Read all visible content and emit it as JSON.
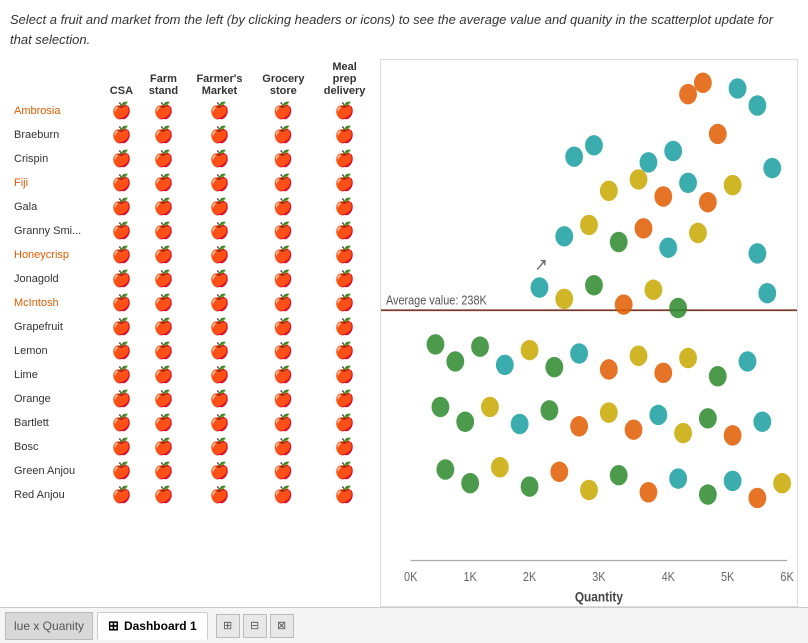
{
  "instruction": "Select a fruit and market from the left (by clicking  headers or icons) to see the average value and quanity in the scatterplot update for that selection.",
  "columns": [
    "CSA",
    "Farm stand",
    "Farmer's Market",
    "Grocery store",
    "Meal prep delivery"
  ],
  "fruits": [
    {
      "name": "Ambrosia",
      "highlight": true
    },
    {
      "name": "Braeburn",
      "highlight": false
    },
    {
      "name": "Crispin",
      "highlight": false
    },
    {
      "name": "Fiji",
      "highlight": true
    },
    {
      "name": "Gala",
      "highlight": false
    },
    {
      "name": "Granny Smi...",
      "highlight": false
    },
    {
      "name": "Honeycrisp",
      "highlight": true
    },
    {
      "name": "Jonagold",
      "highlight": false
    },
    {
      "name": "McIntosh",
      "highlight": true
    },
    {
      "name": "Grapefruit",
      "highlight": false
    },
    {
      "name": "Lemon",
      "highlight": false
    },
    {
      "name": "Lime",
      "highlight": false
    },
    {
      "name": "Orange",
      "highlight": false
    },
    {
      "name": "Bartlett",
      "highlight": false
    },
    {
      "name": "Bosc",
      "highlight": false
    },
    {
      "name": "Green Anjou",
      "highlight": false
    },
    {
      "name": "Red Anjou",
      "highlight": false
    }
  ],
  "avg_line_label": "Average value: 238K",
  "x_axis_label": "Quantity",
  "x_ticks": [
    "0K",
    "1K",
    "2K",
    "3K",
    "4K",
    "5K",
    "6K"
  ],
  "scatterplot_title": "",
  "tabs": [
    {
      "label": "lue x Quanity",
      "active": false,
      "partial": true
    },
    {
      "label": "Dashboard 1",
      "active": true,
      "icon": "⊞"
    }
  ],
  "tab_actions": [
    "⊞",
    "⊟",
    "⊠"
  ],
  "colors": {
    "teal": "#1a9fa0",
    "green": "#2d8a2d",
    "orange": "#e05c00",
    "yellow": "#c8a800",
    "dark": "#1a2a3a",
    "avg_line": "#7a3a2a"
  }
}
